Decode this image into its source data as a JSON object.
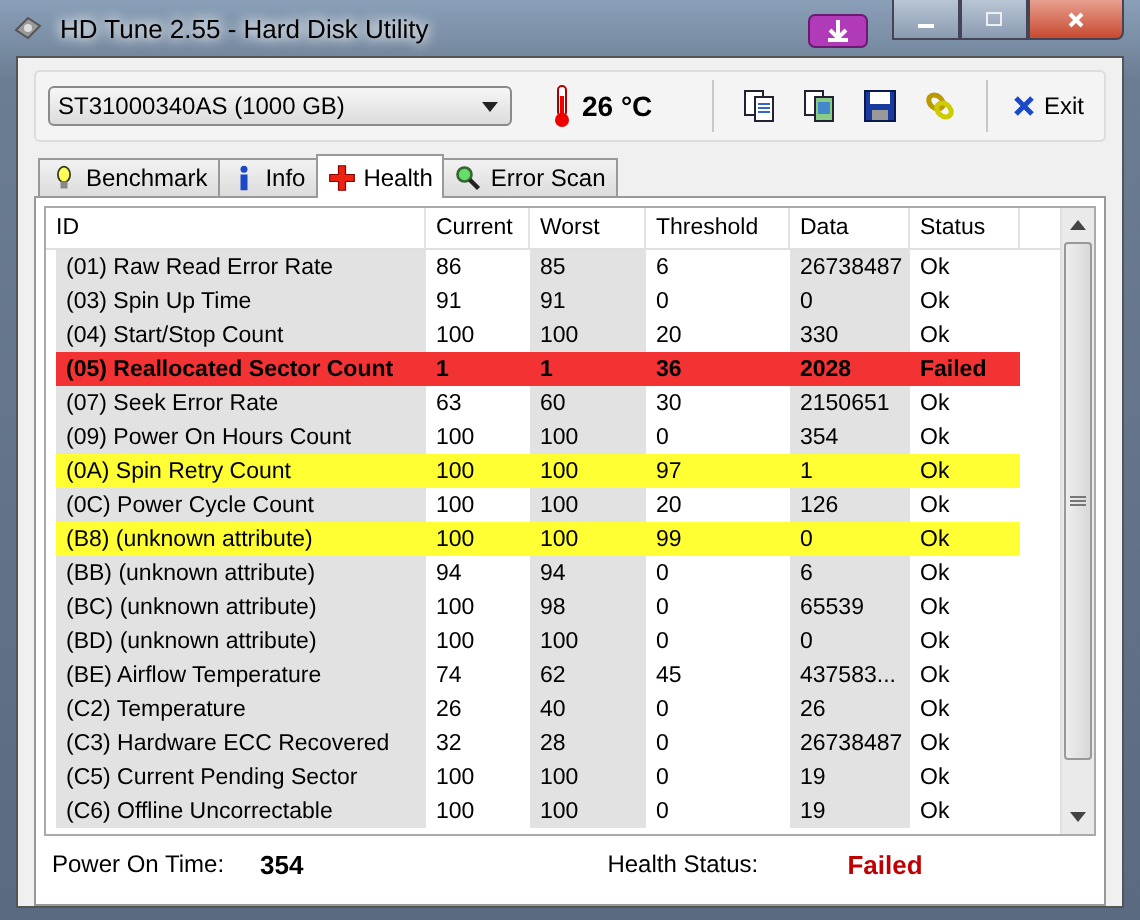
{
  "window": {
    "title": "HD Tune 2.55 - Hard Disk Utility"
  },
  "toolbar": {
    "drive": "ST31000340AS (1000 GB)",
    "temperature": "26 °C",
    "exit_label": "Exit"
  },
  "tabs": [
    {
      "label": "Benchmark",
      "selected": false
    },
    {
      "label": "Info",
      "selected": false
    },
    {
      "label": "Health",
      "selected": true
    },
    {
      "label": "Error Scan",
      "selected": false
    }
  ],
  "table": {
    "columns": [
      "ID",
      "Current",
      "Worst",
      "Threshold",
      "Data",
      "Status"
    ],
    "rows": [
      {
        "kind": "normal",
        "cells": [
          "(01) Raw Read Error Rate",
          "86",
          "85",
          "6",
          "26738487",
          "Ok"
        ]
      },
      {
        "kind": "normal",
        "cells": [
          "(03) Spin Up Time",
          "91",
          "91",
          "0",
          "0",
          "Ok"
        ]
      },
      {
        "kind": "normal",
        "cells": [
          "(04) Start/Stop Count",
          "100",
          "100",
          "20",
          "330",
          "Ok"
        ]
      },
      {
        "kind": "failed",
        "cells": [
          "(05) Reallocated Sector Count",
          "1",
          "1",
          "36",
          "2028",
          "Failed"
        ]
      },
      {
        "kind": "normal",
        "cells": [
          "(07) Seek Error Rate",
          "63",
          "60",
          "30",
          "2150651",
          "Ok"
        ]
      },
      {
        "kind": "normal",
        "cells": [
          "(09) Power On Hours Count",
          "100",
          "100",
          "0",
          "354",
          "Ok"
        ]
      },
      {
        "kind": "warning",
        "cells": [
          "(0A) Spin Retry Count",
          "100",
          "100",
          "97",
          "1",
          "Ok"
        ]
      },
      {
        "kind": "normal",
        "cells": [
          "(0C) Power Cycle Count",
          "100",
          "100",
          "20",
          "126",
          "Ok"
        ]
      },
      {
        "kind": "warning",
        "cells": [
          "(B8) (unknown attribute)",
          "100",
          "100",
          "99",
          "0",
          "Ok"
        ]
      },
      {
        "kind": "normal",
        "cells": [
          "(BB) (unknown attribute)",
          "94",
          "94",
          "0",
          "6",
          "Ok"
        ]
      },
      {
        "kind": "normal",
        "cells": [
          "(BC) (unknown attribute)",
          "100",
          "98",
          "0",
          "65539",
          "Ok"
        ]
      },
      {
        "kind": "normal",
        "cells": [
          "(BD) (unknown attribute)",
          "100",
          "100",
          "0",
          "0",
          "Ok"
        ]
      },
      {
        "kind": "normal",
        "cells": [
          "(BE) Airflow Temperature",
          "74",
          "62",
          "45",
          "437583...",
          "Ok"
        ]
      },
      {
        "kind": "normal",
        "cells": [
          "(C2) Temperature",
          "26",
          "40",
          "0",
          "26",
          "Ok"
        ]
      },
      {
        "kind": "normal",
        "cells": [
          "(C3) Hardware ECC Recovered",
          "32",
          "28",
          "0",
          "26738487",
          "Ok"
        ]
      },
      {
        "kind": "normal",
        "cells": [
          "(C5) Current Pending Sector",
          "100",
          "100",
          "0",
          "19",
          "Ok"
        ]
      },
      {
        "kind": "normal",
        "cells": [
          "(C6) Offline Uncorrectable",
          "100",
          "100",
          "0",
          "19",
          "Ok"
        ]
      }
    ]
  },
  "footer": {
    "power_on_label": "Power On Time:",
    "power_on_value": "354",
    "health_label": "Health Status:",
    "health_value": "Failed"
  }
}
